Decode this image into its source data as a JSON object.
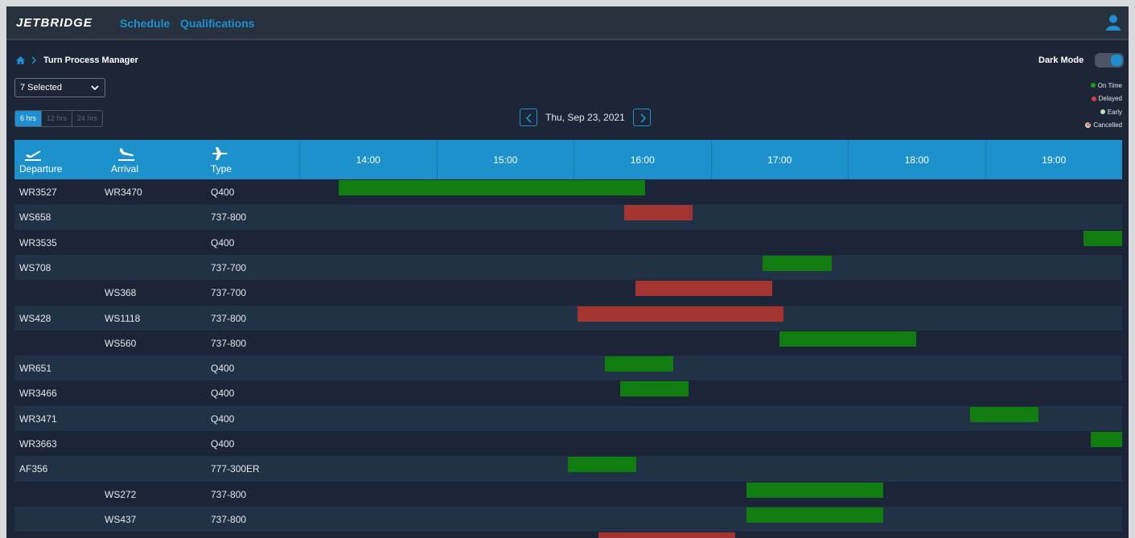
{
  "app": {
    "logo": "JETBRIDGE"
  },
  "nav": [
    {
      "label": "Schedule"
    },
    {
      "label": "Qualifications"
    }
  ],
  "breadcrumb": {
    "current": "Turn Process Manager"
  },
  "dark_mode": {
    "label": "Dark Mode",
    "enabled": true
  },
  "filter": {
    "selected_label": "7 Selected"
  },
  "ranges": [
    {
      "label": "6 hrs",
      "active": true
    },
    {
      "label": "12 hrs",
      "active": false
    },
    {
      "label": "24 hrs",
      "active": false
    }
  ],
  "date_nav": {
    "date": "Thu, Sep 23, 2021"
  },
  "legend": [
    {
      "label": "On Time",
      "color": "#1a9a1a"
    },
    {
      "label": "Delayed",
      "color": "#d14141"
    },
    {
      "label": "Early",
      "color": "#b9e6b9"
    },
    {
      "label": "Cancelled",
      "color": "#c0392b"
    }
  ],
  "columns": {
    "departure": "Departure",
    "arrival": "Arrival",
    "type": "Type"
  },
  "timeline": {
    "hours": [
      "14:00",
      "15:00",
      "16:00",
      "17:00",
      "18:00",
      "19:00"
    ],
    "start_hour": 13.5,
    "end_hour": 19.5
  },
  "flights": [
    {
      "departure": "WR3527",
      "arrival": "WR3470",
      "type": "Q400",
      "start": 13.79,
      "end": 16.02,
      "status": "on_time"
    },
    {
      "departure": "WS658",
      "arrival": "",
      "type": "737-800",
      "start": 15.87,
      "end": 16.37,
      "status": "delayed"
    },
    {
      "departure": "WR3535",
      "arrival": "",
      "type": "Q400",
      "start": 19.22,
      "end": 19.5,
      "status": "on_time"
    },
    {
      "departure": "WS708",
      "arrival": "",
      "type": "737-700",
      "start": 16.88,
      "end": 17.38,
      "status": "on_time"
    },
    {
      "departure": "",
      "arrival": "WS368",
      "type": "737-700",
      "start": 15.95,
      "end": 16.95,
      "status": "delayed"
    },
    {
      "departure": "WS428",
      "arrival": "WS1118",
      "type": "737-800",
      "start": 15.53,
      "end": 17.03,
      "status": "delayed"
    },
    {
      "departure": "",
      "arrival": "WS560",
      "type": "737-800",
      "start": 17.0,
      "end": 18.0,
      "status": "on_time"
    },
    {
      "departure": "WR651",
      "arrival": "",
      "type": "Q400",
      "start": 15.73,
      "end": 16.23,
      "status": "on_time"
    },
    {
      "departure": "WR3466",
      "arrival": "",
      "type": "Q400",
      "start": 15.84,
      "end": 16.34,
      "status": "on_time"
    },
    {
      "departure": "WR3471",
      "arrival": "",
      "type": "Q400",
      "start": 18.39,
      "end": 18.89,
      "status": "on_time"
    },
    {
      "departure": "WR3663",
      "arrival": "",
      "type": "Q400",
      "start": 19.27,
      "end": 19.5,
      "status": "on_time"
    },
    {
      "departure": "AF356",
      "arrival": "",
      "type": "777-300ER",
      "start": 15.46,
      "end": 15.96,
      "status": "on_time"
    },
    {
      "departure": "",
      "arrival": "WS272",
      "type": "737-800",
      "start": 16.76,
      "end": 17.76,
      "status": "on_time"
    },
    {
      "departure": "",
      "arrival": "WS437",
      "type": "737-800",
      "start": 16.76,
      "end": 17.76,
      "status": "on_time"
    },
    {
      "departure": "",
      "arrival": "",
      "type": "",
      "start": 15.68,
      "end": 16.68,
      "status": "delayed"
    }
  ]
}
